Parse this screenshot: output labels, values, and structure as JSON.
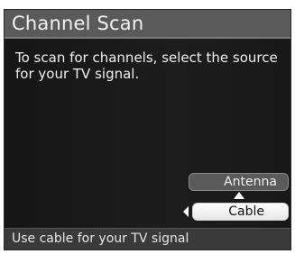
{
  "dialog": {
    "title": "Channel Scan",
    "instructions": "To scan for channels, select the source for your TV signal."
  },
  "options": [
    {
      "label": "Antenna",
      "selected": false
    },
    {
      "label": "Cable",
      "selected": true
    }
  ],
  "status": {
    "text": "Use cable for your TV signal"
  },
  "icons": {
    "left_arrow": "left-arrow-icon",
    "up_arrow": "up-arrow-icon"
  },
  "colors": {
    "title_bar": "#5a5a5a",
    "background": "#111111",
    "selected_button": "#ffffff",
    "unselected_button": "#5a5a5a",
    "status_bar": "#3a3a3a"
  }
}
